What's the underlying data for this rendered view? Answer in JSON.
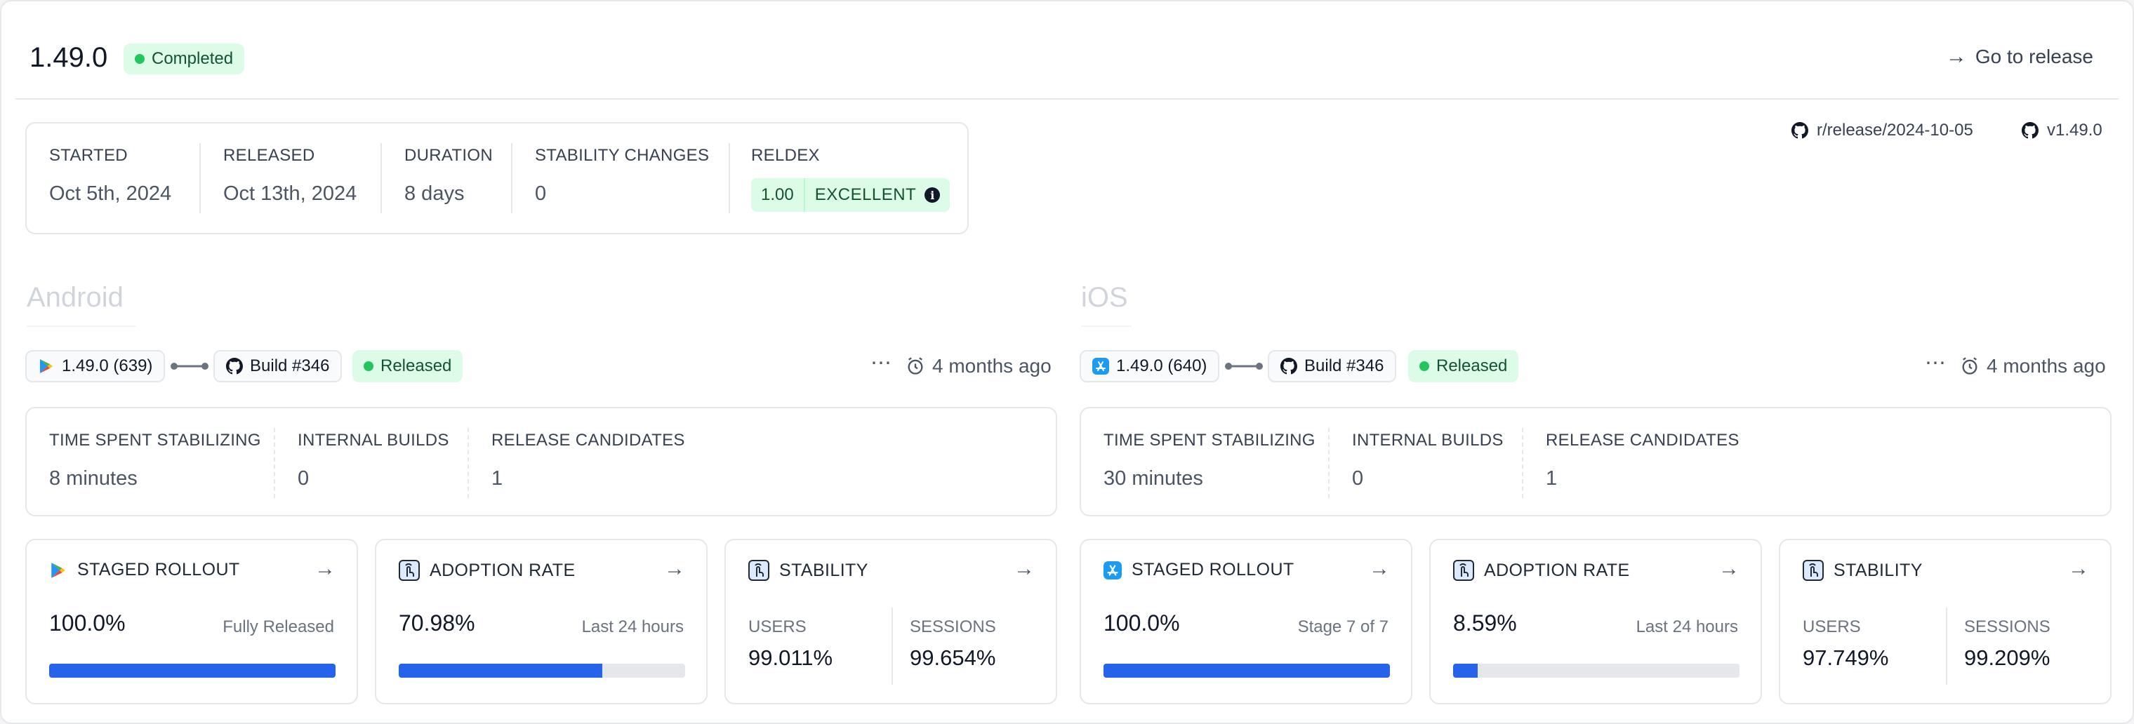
{
  "release": {
    "version": "1.49.0",
    "status": "Completed",
    "go_to_release": "Go to release",
    "branch": "r/release/2024-10-05",
    "tag": "v1.49.0"
  },
  "summary": {
    "started_label": "STARTED",
    "started_value": "Oct 5th, 2024",
    "released_label": "RELEASED",
    "released_value": "Oct 13th, 2024",
    "duration_label": "DURATION",
    "duration_value": "8 days",
    "stability_label": "STABILITY CHANGES",
    "stability_value": "0",
    "reldex_label": "RELDEX",
    "reldex_score": "1.00",
    "reldex_grade": "EXCELLENT"
  },
  "colors": {
    "accent": "#2563eb",
    "success": "#22c55e",
    "success_bg": "#dcfce7",
    "border": "#e5e7eb"
  },
  "platforms": [
    {
      "name": "Android",
      "version_chip": "1.49.0 (639)",
      "build_chip": "Build #346",
      "status": "Released",
      "time_ago": "4 months ago",
      "stats": {
        "tss_label": "TIME SPENT STABILIZING",
        "tss_value": "8 minutes",
        "ib_label": "INTERNAL BUILDS",
        "ib_value": "0",
        "rc_label": "RELEASE CANDIDATES",
        "rc_value": "1"
      },
      "rollout": {
        "title": "STAGED ROLLOUT",
        "value": "100.0%",
        "note": "Fully Released",
        "progress": 100
      },
      "adoption": {
        "title": "ADOPTION RATE",
        "value": "70.98%",
        "note": "Last 24 hours",
        "progress": 70.98
      },
      "stability": {
        "title": "STABILITY",
        "users_label": "USERS",
        "users_value": "99.011%",
        "sessions_label": "SESSIONS",
        "sessions_value": "99.654%"
      }
    },
    {
      "name": "iOS",
      "version_chip": "1.49.0 (640)",
      "build_chip": "Build #346",
      "status": "Released",
      "time_ago": "4 months ago",
      "stats": {
        "tss_label": "TIME SPENT STABILIZING",
        "tss_value": "30 minutes",
        "ib_label": "INTERNAL BUILDS",
        "ib_value": "0",
        "rc_label": "RELEASE CANDIDATES",
        "rc_value": "1"
      },
      "rollout": {
        "title": "STAGED ROLLOUT",
        "value": "100.0%",
        "note": "Stage 7 of 7",
        "progress": 100
      },
      "adoption": {
        "title": "ADOPTION RATE",
        "value": "8.59%",
        "note": "Last 24 hours",
        "progress": 8.59
      },
      "stability": {
        "title": "STABILITY",
        "users_label": "USERS",
        "users_value": "97.749%",
        "sessions_label": "SESSIONS",
        "sessions_value": "99.209%"
      }
    }
  ]
}
